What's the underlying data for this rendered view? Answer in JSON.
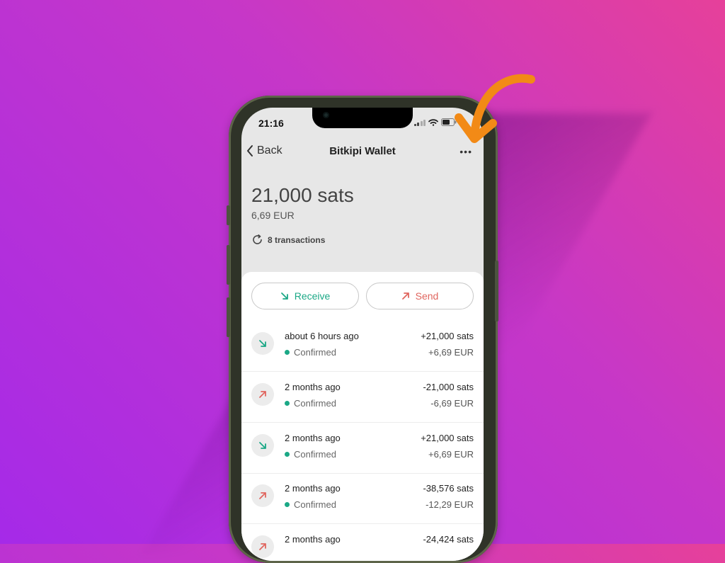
{
  "status": {
    "time": "21:16"
  },
  "nav": {
    "back_label": "Back",
    "title": "Bitkipi Wallet",
    "more_label": "•••"
  },
  "wallet": {
    "balance": "21,000 sats",
    "fiat": "6,69 EUR",
    "tx_count": "8 transactions"
  },
  "actions": {
    "receive_label": "Receive",
    "send_label": "Send"
  },
  "colors": {
    "receive": "#1ba886",
    "send": "#e0665f",
    "annotation": "#f28a16"
  },
  "transactions": [
    {
      "direction": "in",
      "time": "about 6 hours ago",
      "status": "Confirmed",
      "amount": "+21,000 sats",
      "fiat": "+6,69 EUR"
    },
    {
      "direction": "out",
      "time": "2 months ago",
      "status": "Confirmed",
      "amount": "-21,000 sats",
      "fiat": "-6,69 EUR"
    },
    {
      "direction": "in",
      "time": "2 months ago",
      "status": "Confirmed",
      "amount": "+21,000 sats",
      "fiat": "+6,69 EUR"
    },
    {
      "direction": "out",
      "time": "2 months ago",
      "status": "Confirmed",
      "amount": "-38,576 sats",
      "fiat": "-12,29 EUR"
    },
    {
      "direction": "out",
      "time": "2 months ago",
      "status": "",
      "amount": "-24,424 sats",
      "fiat": ""
    }
  ]
}
